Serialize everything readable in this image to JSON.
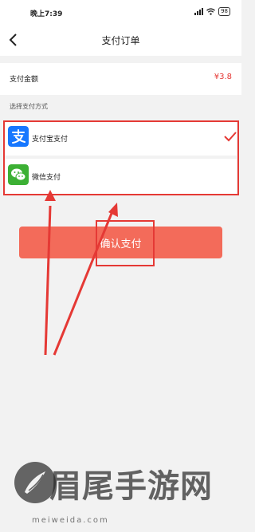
{
  "status_bar": {
    "time": "晚上7:39",
    "battery": "98"
  },
  "header": {
    "title": "支付订单"
  },
  "amount": {
    "label": "支付金额",
    "value": "¥3.8"
  },
  "section": {
    "label": "选择支付方式"
  },
  "payment_methods": [
    {
      "label": "支付宝支付",
      "icon": "alipay-icon",
      "color": "#1677ff",
      "selected": true
    },
    {
      "label": "微信支付",
      "icon": "wechat-icon",
      "color": "#3cb034",
      "selected": false
    }
  ],
  "confirm": {
    "label": "确认支付"
  },
  "colors": {
    "accent": "#e53935",
    "button": "#f36b5a"
  },
  "watermark": {
    "brand": "眉尾手游网",
    "pinyin": "meiweida.com"
  }
}
